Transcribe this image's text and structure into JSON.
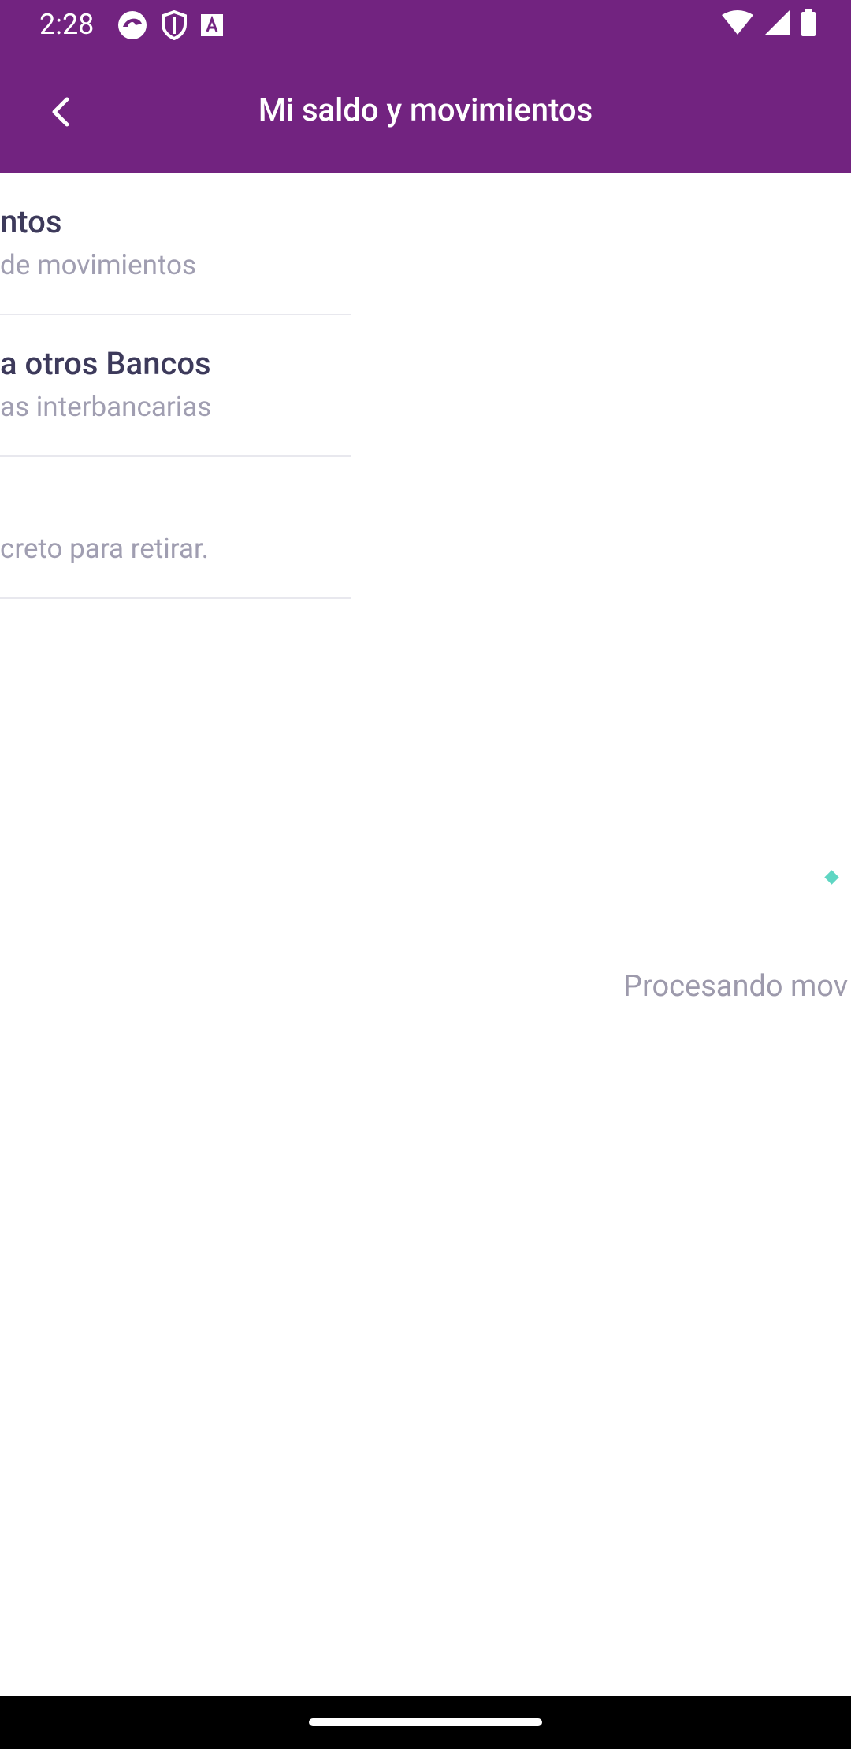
{
  "status_bar": {
    "time": "2:28",
    "left_icons": [
      "app-notification-icon",
      "shield-icon",
      "text-a-icon"
    ],
    "right_icons": [
      "wifi-icon",
      "signal-icon",
      "battery-icon"
    ]
  },
  "app_bar": {
    "title": "Mi saldo y movimientos",
    "back_icon": "chevron-left-icon",
    "background": "#722380"
  },
  "menu": {
    "items": [
      {
        "title": "ntos",
        "subtitle": "de movimientos"
      },
      {
        "title": "a otros Bancos",
        "subtitle": "as interbancarias"
      },
      {
        "title": "",
        "subtitle": "creto para retirar."
      }
    ]
  },
  "loading": {
    "text": "Procesando mov",
    "accent": "#5fd6c3"
  },
  "nav_bar": {
    "home_indicator": "home-pill"
  }
}
